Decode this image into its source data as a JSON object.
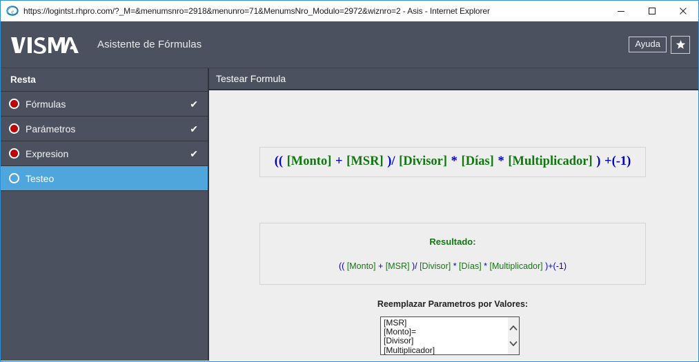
{
  "titlebar": {
    "icon": "internet-explorer-icon",
    "text": "https://logintst.rhpro.com/?_M=&menumsnro=2918&menunro=71&MenumsNro_Modulo=2972&wiznro=2 - Asis - Internet Explorer",
    "minimize_label": "minimize-icon",
    "maximize_label": "maximize-icon",
    "close_label": "close-icon"
  },
  "header": {
    "logo_text": "VISMA",
    "subtitle": "Asistente de Fórmulas",
    "help_button": "Ayuda",
    "favorite_button": "star-icon"
  },
  "sidebar": {
    "title": "Resta",
    "items": [
      {
        "label": "Fórmulas",
        "state": "done",
        "check": "✔"
      },
      {
        "label": "Parámetros",
        "state": "done",
        "check": "✔"
      },
      {
        "label": "Expresion",
        "state": "done",
        "check": "✔"
      },
      {
        "label": "Testeo",
        "state": "current",
        "check": ""
      }
    ]
  },
  "main": {
    "header_title": "Testear Formula",
    "formula": {
      "full_text": "(( [Monto] + [MSR] )/ [Divisor] * [Días] * [Multiplicador] ) +(-1)",
      "tokens": [
        {
          "text": "(( ",
          "type": "op"
        },
        {
          "text": "[Monto]",
          "type": "var"
        },
        {
          "text": " + ",
          "type": "op"
        },
        {
          "text": "[MSR]",
          "type": "var"
        },
        {
          "text": " )/ ",
          "type": "op"
        },
        {
          "text": "[Divisor]",
          "type": "var"
        },
        {
          "text": " * ",
          "type": "op"
        },
        {
          "text": "[Días]",
          "type": "var"
        },
        {
          "text": " * ",
          "type": "op"
        },
        {
          "text": "[Multiplicador]",
          "type": "var"
        },
        {
          "text": " ) +(-1)",
          "type": "op"
        }
      ]
    },
    "result": {
      "title": "Resultado:",
      "expression_text": "(( [Monto] + [MSR] )/ [Divisor] * [Días] * [Multiplicador] )+(-1)",
      "tokens": [
        {
          "text": "(( ",
          "type": "op"
        },
        {
          "text": "[Monto]",
          "type": "var"
        },
        {
          "text": " + ",
          "type": "op"
        },
        {
          "text": "[MSR]",
          "type": "var"
        },
        {
          "text": " )/ ",
          "type": "op"
        },
        {
          "text": "[Divisor]",
          "type": "var"
        },
        {
          "text": " * ",
          "type": "op"
        },
        {
          "text": "[Días]",
          "type": "var"
        },
        {
          "text": " * ",
          "type": "op"
        },
        {
          "text": "[Multiplicador]",
          "type": "var"
        },
        {
          "text": " )+(-1)",
          "type": "op"
        }
      ]
    },
    "replace_label": "Reemplazar Parametros por Valores:",
    "parameter_list": {
      "items": [
        "[MSR]",
        "[Monto]=",
        "[Divisor]",
        "[Multiplicador]"
      ],
      "scroll_up": "chevron-up-icon",
      "scroll_down": "chevron-down-icon"
    }
  },
  "colors": {
    "chrome_dark": "#4b515e",
    "accent_blue": "#4fa6dd",
    "window_border": "#2b8fd6",
    "operator_blue": "#0000cc",
    "variable_green": "#117711",
    "bullet_red": "#c00000",
    "content_bg": "#eeeeee"
  }
}
